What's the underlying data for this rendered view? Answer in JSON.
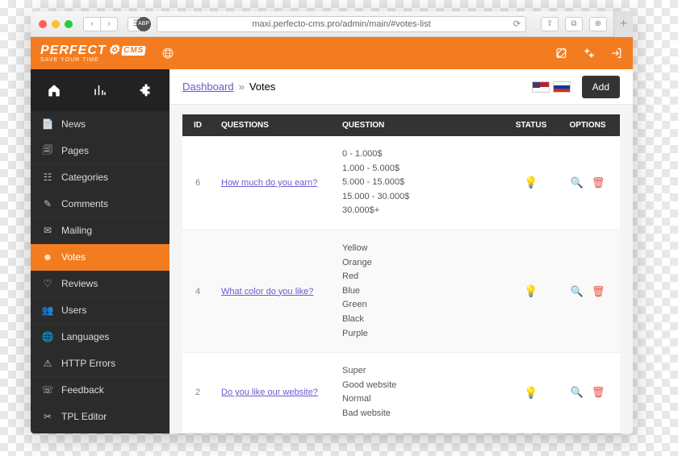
{
  "browser": {
    "url": "maxi.perfecto-cms.pro/admin/main/#votes-list"
  },
  "logo": {
    "brand": "PERFECT",
    "badge": "CMS",
    "tagline": "SAVE YOUR TIME"
  },
  "nav": {
    "items": [
      {
        "label": "News"
      },
      {
        "label": "Pages"
      },
      {
        "label": "Categories"
      },
      {
        "label": "Comments"
      },
      {
        "label": "Mailing"
      },
      {
        "label": "Votes"
      },
      {
        "label": "Reviews"
      },
      {
        "label": "Users"
      },
      {
        "label": "Languages"
      },
      {
        "label": "HTTP Errors"
      },
      {
        "label": "Feedback"
      },
      {
        "label": "TPL Editor"
      }
    ]
  },
  "breadcrumb": {
    "root": "Dashboard",
    "sep": "»",
    "current": "Votes"
  },
  "actions": {
    "add": "Add"
  },
  "table": {
    "headers": {
      "id": "ID",
      "questions": "QUESTIONS",
      "question": "QUESTION",
      "status": "STATUS",
      "options": "OPTIONS"
    },
    "rows": [
      {
        "id": "6",
        "title": "How much do you earn?",
        "answers": [
          "0 - 1.000$",
          "1.000 - 5.000$",
          "5.000 - 15.000$",
          "15.000 - 30.000$",
          "30.000$+"
        ]
      },
      {
        "id": "4",
        "title": "What color do you like?",
        "answers": [
          "Yellow",
          "Orange",
          "Red",
          "Blue",
          "Green",
          "Black",
          "Purple"
        ]
      },
      {
        "id": "2",
        "title": "Do you like our website?",
        "answers": [
          "Super",
          "Good website",
          "Normal",
          "Bad website"
        ]
      }
    ]
  }
}
